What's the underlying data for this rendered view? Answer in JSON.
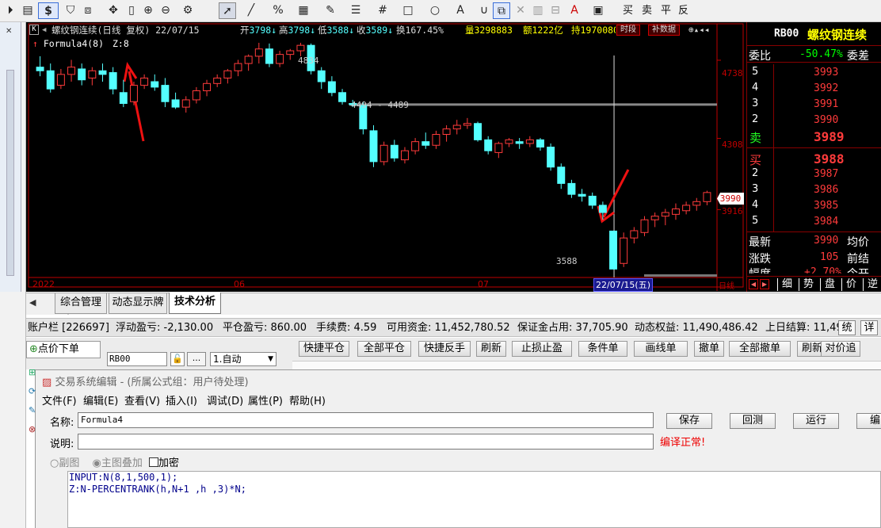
{
  "toolbar": {
    "icons": [
      "play-circle-icon",
      "document-icon",
      "dollar-icon",
      "filter-icon",
      "chart-compare-icon",
      "move-icon",
      "vertical-bar-icon",
      "zoom-in-icon",
      "zoom-out-icon",
      "gear-icon",
      "cursor-icon",
      "line-draw-icon",
      "percent-icon",
      "calendar-grid-icon",
      "pen-icon",
      "align-icon",
      "hash-icon",
      "rectangle-icon",
      "circle-icon",
      "text-a-icon",
      "magnet-icon",
      "copy-icon",
      "delete-icon",
      "trash-icon",
      "lock-icon",
      "font-color-icon",
      "save-icon"
    ],
    "trade_buttons": [
      "买",
      "卖",
      "平",
      "反"
    ]
  },
  "chart": {
    "symbol_info": "螺纹钢连续(日线 复权) 22/07/15",
    "open_label": "开",
    "open_value": "3798",
    "high_label": "高",
    "high_value": "3798",
    "low_label": "低",
    "low_value": "3588",
    "close_label": "收",
    "close_value": "3589",
    "turnover_label": "换",
    "turnover_value": "167.45%",
    "volume_label": "量",
    "volume_value": "3298883",
    "amount_label": "额",
    "amount_value": "1222亿",
    "oi_label": "持",
    "oi_value": "1970080",
    "period_button": "时段",
    "adjust_button": "补数据",
    "formula_label": "Formula4(8)",
    "formula_value": "Z:8",
    "price_labels": [
      "4738",
      "4308",
      "3916"
    ],
    "current_price_tag": "3990",
    "annot_high": "4834",
    "annot_range": "4494 - 4489",
    "annot_low": "3588",
    "date_labels": [
      "2022",
      "06",
      "07"
    ],
    "cursor_date": "22/07/15(五)",
    "period_tag": "日线",
    "colors": {
      "up": "#ff3b3b",
      "down": "#54ffff",
      "bg": "#000000",
      "axis": "#c00000"
    }
  },
  "chart_data": {
    "type": "candlestick",
    "series": [
      {
        "name": "K",
        "values": [
          [
            4700,
            4760,
            4650,
            4680
          ],
          [
            4680,
            4720,
            4560,
            4580
          ],
          [
            4600,
            4690,
            4580,
            4660
          ],
          [
            4660,
            4740,
            4620,
            4700
          ],
          [
            4690,
            4720,
            4600,
            4630
          ],
          [
            4640,
            4700,
            4600,
            4680
          ],
          [
            4680,
            4720,
            4620,
            4660
          ],
          [
            4670,
            4700,
            4550,
            4580
          ],
          [
            4560,
            4630,
            4480,
            4500
          ],
          [
            4510,
            4620,
            4490,
            4600
          ],
          [
            4600,
            4660,
            4580,
            4640
          ],
          [
            4620,
            4660,
            4570,
            4590
          ],
          [
            4600,
            4640,
            4480,
            4510
          ],
          [
            4520,
            4560,
            4470,
            4480
          ],
          [
            4480,
            4540,
            4450,
            4520
          ],
          [
            4520,
            4590,
            4500,
            4570
          ],
          [
            4570,
            4630,
            4540,
            4610
          ],
          [
            4610,
            4660,
            4590,
            4640
          ],
          [
            4640,
            4690,
            4610,
            4680
          ],
          [
            4680,
            4740,
            4650,
            4720
          ],
          [
            4720,
            4770,
            4680,
            4760
          ],
          [
            4760,
            4834,
            4720,
            4800
          ],
          [
            4800,
            4830,
            4700,
            4720
          ],
          [
            4720,
            4790,
            4700,
            4770
          ],
          [
            4770,
            4800,
            4740,
            4790
          ],
          [
            4790,
            4834,
            4760,
            4820
          ],
          [
            4820,
            4830,
            4660,
            4680
          ],
          [
            4680,
            4700,
            4580,
            4620
          ],
          [
            4620,
            4650,
            4540,
            4560
          ],
          [
            4560,
            4580,
            4494,
            4510
          ],
          [
            4500,
            4520,
            4480,
            4494
          ],
          [
            4490,
            4510,
            4330,
            4360
          ],
          [
            4350,
            4380,
            4150,
            4180
          ],
          [
            4180,
            4290,
            4160,
            4270
          ],
          [
            4270,
            4300,
            4180,
            4200
          ],
          [
            4190,
            4260,
            4170,
            4240
          ],
          [
            4240,
            4310,
            4220,
            4290
          ],
          [
            4290,
            4340,
            4250,
            4270
          ],
          [
            4270,
            4350,
            4250,
            4330
          ],
          [
            4330,
            4380,
            4290,
            4360
          ],
          [
            4360,
            4410,
            4330,
            4380
          ],
          [
            4380,
            4420,
            4360,
            4390
          ],
          [
            4390,
            4400,
            4290,
            4300
          ],
          [
            4300,
            4320,
            4220,
            4240
          ],
          [
            4230,
            4290,
            4200,
            4280
          ],
          [
            4280,
            4310,
            4260,
            4300
          ],
          [
            4290,
            4310,
            4250,
            4280
          ],
          [
            4280,
            4320,
            4260,
            4300
          ],
          [
            4300,
            4310,
            4240,
            4260
          ],
          [
            4260,
            4280,
            4130,
            4150
          ],
          [
            4150,
            4170,
            4030,
            4060
          ],
          [
            4060,
            4080,
            3980,
            4000
          ],
          [
            4000,
            4030,
            3960,
            3990
          ],
          [
            3990,
            4010,
            3920,
            3940
          ],
          [
            3940,
            3960,
            3860,
            3900
          ],
          [
            3798,
            3798,
            3588,
            3589
          ],
          [
            3620,
            3790,
            3600,
            3760
          ],
          [
            3760,
            3820,
            3730,
            3800
          ],
          [
            3790,
            3880,
            3770,
            3860
          ],
          [
            3860,
            3900,
            3820,
            3880
          ],
          [
            3880,
            3920,
            3830,
            3900
          ],
          [
            3890,
            3950,
            3860,
            3920
          ],
          [
            3910,
            3960,
            3890,
            3940
          ],
          [
            3940,
            3980,
            3910,
            3960
          ],
          [
            3960,
            4020,
            3940,
            4010
          ]
        ]
      }
    ],
    "ylim": [
      3560,
      4860
    ]
  },
  "orderbook": {
    "title_code": "RB00",
    "title_name": "螺纹钢连续",
    "ratio_label": "委比",
    "ratio_value": "-50.47%",
    "diff_label": "委差",
    "asks": [
      {
        "lvl": "5",
        "price": "3993"
      },
      {
        "lvl": "4",
        "price": "3992"
      },
      {
        "lvl": "3",
        "price": "3991"
      },
      {
        "lvl": "2",
        "price": "3990"
      },
      {
        "lvl": "卖",
        "price": "3989"
      }
    ],
    "bids": [
      {
        "lvl": "买",
        "price": "3988"
      },
      {
        "lvl": "2",
        "price": "3987"
      },
      {
        "lvl": "3",
        "price": "3986"
      },
      {
        "lvl": "4",
        "price": "3985"
      },
      {
        "lvl": "5",
        "price": "3984"
      }
    ],
    "last_label": "最新",
    "last_value": "3990",
    "avg_label": "均价",
    "chg_label": "涨跌",
    "chg_value": "105",
    "prev_label": "前结",
    "pct_label": "幅度",
    "pct_value": "+2.70%",
    "open_label": "今开",
    "tabs": [
      "细",
      "势",
      "盘",
      "价",
      "逆"
    ]
  },
  "tabs": {
    "items": [
      "综合管理",
      "动态显示牌",
      "技术分析"
    ],
    "active": "技术分析"
  },
  "account": {
    "label": "账户栏 [226697]",
    "float_pl": "浮动盈亏: -2,130.00",
    "close_pl": "平仓盈亏: 860.00",
    "fee": "手续费: 4.59",
    "available": "可用资金: 11,452,780.52",
    "margin": "保证金占用: 37,705.90",
    "equity": "动态权益: 11,490,486.42",
    "prev_settle": "上日结算: 11,49",
    "btn_stat": "统",
    "btn_detail": "详"
  },
  "order": {
    "tab_label": "点价下单",
    "symbol_value": "RB00",
    "mode_value": "1.自动",
    "buttons": [
      "快捷平仓",
      "全部平仓",
      "快捷反手",
      "刷新",
      "止损止盈",
      "条件单",
      "画线单",
      "撤单",
      "全部撤单",
      "刷新",
      "对价追"
    ]
  },
  "editor": {
    "title": "交易系统编辑 - (所属公式组：用户待处理)",
    "menu": [
      "文件(F)",
      "编辑(E)",
      "查看(V)",
      "插入(I)",
      "调试(D)",
      "属性(P)",
      "帮助(H)"
    ],
    "name_label": "名称:",
    "name_value": "Formula4",
    "desc_label": "说明:",
    "desc_value": "",
    "compile_status": "编译正常!",
    "buttons": [
      "保存",
      "回测",
      "运行",
      "编"
    ],
    "opt_sub": "副图",
    "opt_main": "主图叠加",
    "opt_encrypt": "加密",
    "code_lines": [
      "INPUT:N(8,1,500,1);",
      "Z:N-PERCENTRANK(h,N+1 ,h ,3)*N;"
    ]
  }
}
